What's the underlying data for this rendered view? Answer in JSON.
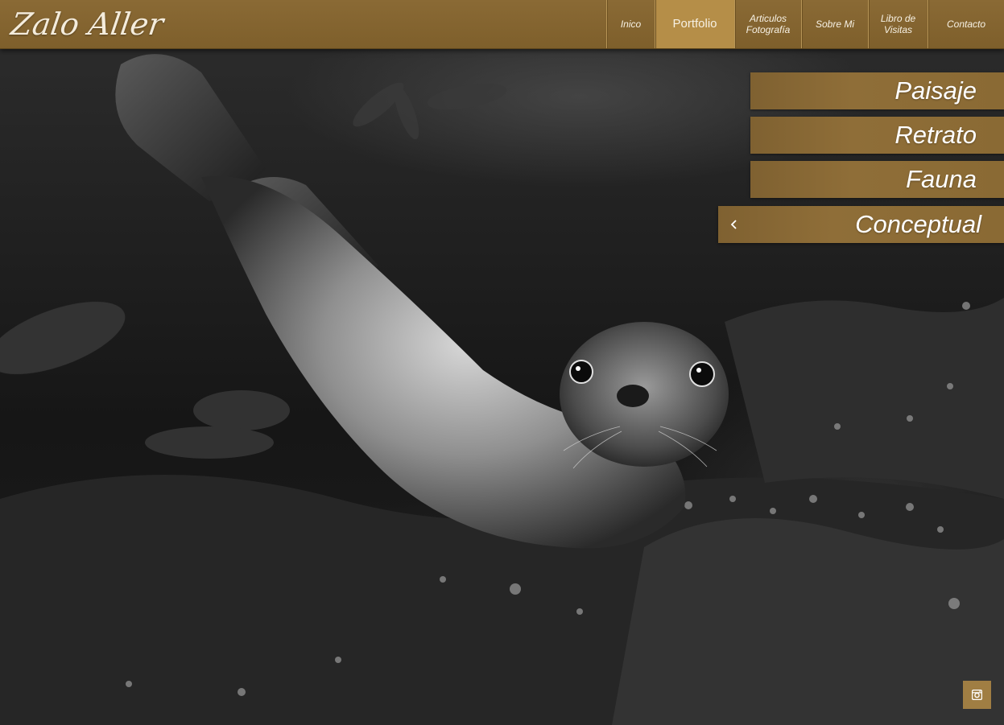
{
  "brand": {
    "logo_text": "Zalo Aller"
  },
  "nav": {
    "items": [
      {
        "label": "Inico",
        "active": false
      },
      {
        "label": "Portfolio",
        "active": true
      },
      {
        "label": "Articulos\nFotografía",
        "active": false
      },
      {
        "label": "Sobre Mi",
        "active": false
      },
      {
        "label": "Libro de\nVisitas",
        "active": false
      },
      {
        "label": "Contacto",
        "active": false
      }
    ]
  },
  "portfolio_menu": {
    "items": [
      {
        "label": "Paisaje"
      },
      {
        "label": "Retrato"
      },
      {
        "label": "Fauna"
      },
      {
        "label": "Conceptual",
        "icon": "chevron-left-icon"
      }
    ]
  },
  "social": {
    "instagram_icon": "instagram-icon"
  },
  "colors": {
    "header": "#7e5f2b",
    "active_tab": "#b58e48",
    "menu_item": "#8a6a34",
    "text": "#ffffff"
  }
}
